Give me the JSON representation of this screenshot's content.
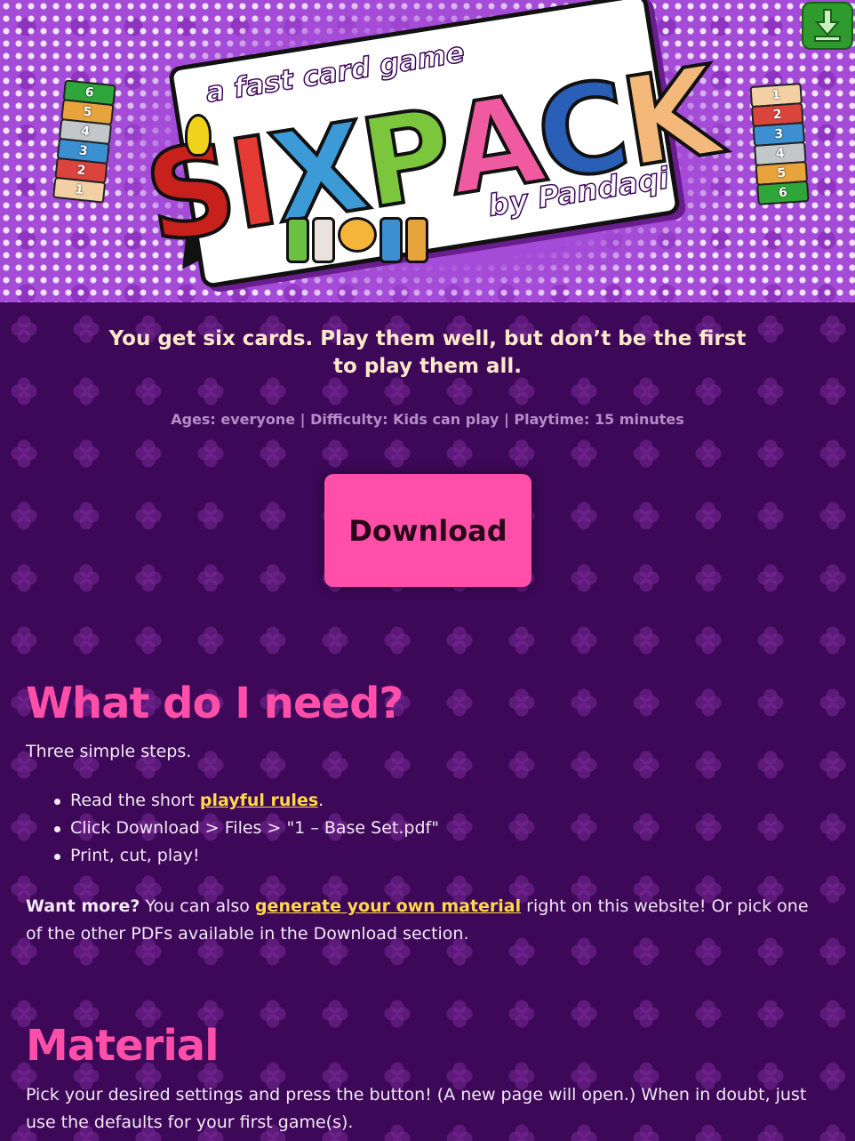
{
  "header": {
    "tagline": "a fast card game",
    "logo_letters": [
      "S",
      "I",
      "X",
      "P",
      "A",
      "C",
      "K"
    ],
    "logo_colors": [
      "#c8201b",
      "#e63a34",
      "#3c9bd6",
      "#7cc63d",
      "#f05aa0",
      "#2a5fb8",
      "#f4b97a"
    ],
    "byline": "by Pandaqi",
    "left_cards": [
      "6",
      "5",
      "4",
      "3",
      "2",
      "1"
    ],
    "left_card_colors": [
      "#2fa63a",
      "#e8a43c",
      "#c3c7c9",
      "#3c8fd0",
      "#d9453c",
      "#f2d0a4"
    ],
    "right_cards": [
      "1",
      "2",
      "3",
      "4",
      "5",
      "6"
    ],
    "right_card_colors": [
      "#f2d0a4",
      "#d9453c",
      "#3c8fd0",
      "#c3c7c9",
      "#e8a43c",
      "#2fa63a"
    ],
    "corner_button_icon": "download-arrow-icon"
  },
  "intro": {
    "lead": "You get six cards. Play them well, but don’t be the first to play them all.",
    "meta": "Ages: everyone | Difficulty: Kids can play | Playtime: 15 minutes"
  },
  "download_button": {
    "label": "Download"
  },
  "need_section": {
    "heading": "What do I need?",
    "intro": "Three simple steps.",
    "step1_prefix": "Read the short ",
    "step1_link": "playful rules",
    "step1_suffix": ".",
    "step2": "Click Download > Files > \"1 – Base Set.pdf\"",
    "step3": "Print, cut, play!",
    "more_bold": "Want more?",
    "more_prefix": " You can also ",
    "more_link": "generate your own material",
    "more_suffix": " right on this website! Or pick one of the other PDFs available in the Download section."
  },
  "material_section": {
    "heading": "Material",
    "text": "Pick your desired settings and press the button! (A new page will open.) When in doubt, just use the defaults for your first game(s)."
  },
  "colors": {
    "accent_pink": "#ff4fa8",
    "link_yellow": "#ffd84a",
    "background_purple": "#3d0858",
    "banner_purple": "#a44bd7"
  }
}
